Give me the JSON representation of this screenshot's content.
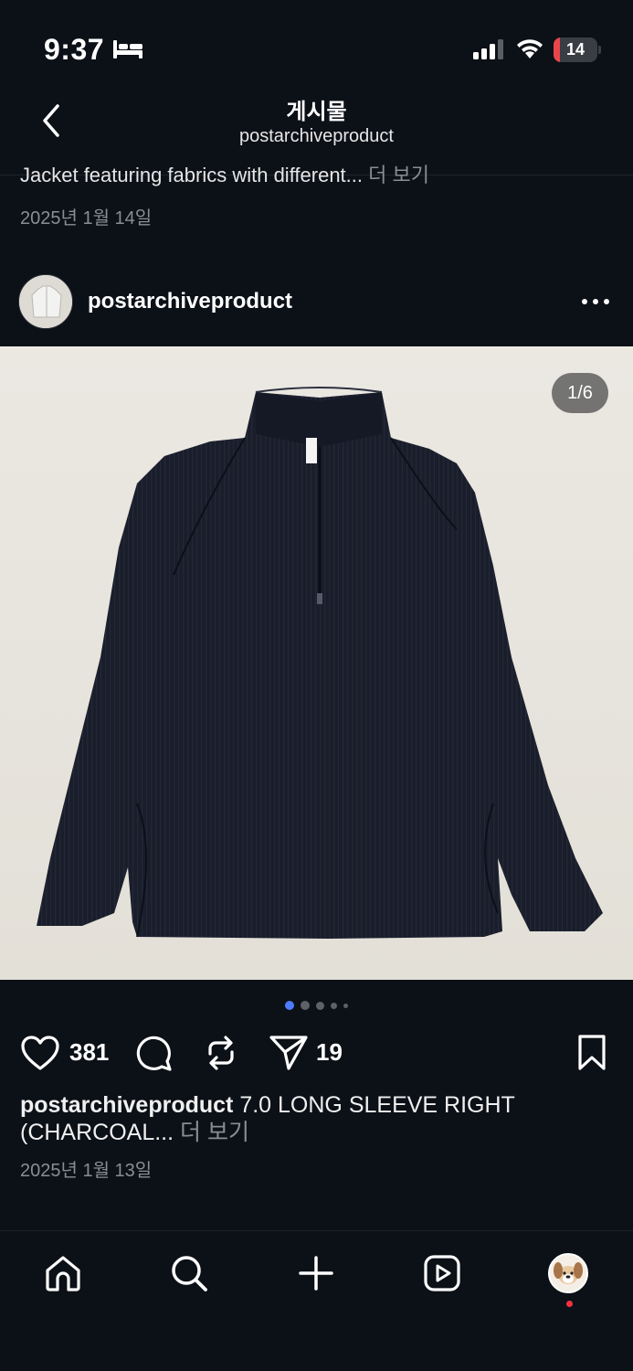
{
  "status_bar": {
    "time": "9:37",
    "battery_level": "14",
    "battery_fraction": 0.14
  },
  "header": {
    "title": "게시물",
    "subtitle": "postarchiveproduct"
  },
  "previous_post": {
    "caption": "Jacket featuring fabrics with different...",
    "more_label": "더 보기",
    "date": "2025년 1월 14일"
  },
  "post": {
    "username": "postarchiveproduct",
    "image_counter": "1/6",
    "likes": "381",
    "shares": "19",
    "caption_text": "7.0 LONG SLEEVE RIGHT (CHARCOAL...",
    "more_label": "더 보기",
    "date": "2025년 1월 13일",
    "carousel": {
      "total_pages": 6,
      "current_page": 1
    }
  },
  "icons": {
    "back": "chevron-left-icon",
    "more": "more-horizontal-icon",
    "like": "heart-icon",
    "comment": "comment-icon",
    "repost": "repost-icon",
    "share": "send-icon",
    "save": "bookmark-icon",
    "home": "home-icon",
    "search": "search-icon",
    "create": "plus-icon",
    "reels": "reels-icon",
    "profile": "profile-avatar"
  },
  "colors": {
    "background": "#0c1017",
    "accent_dot": "#4d7bff",
    "notification": "#ff3040",
    "battery_low": "#e8464a"
  }
}
